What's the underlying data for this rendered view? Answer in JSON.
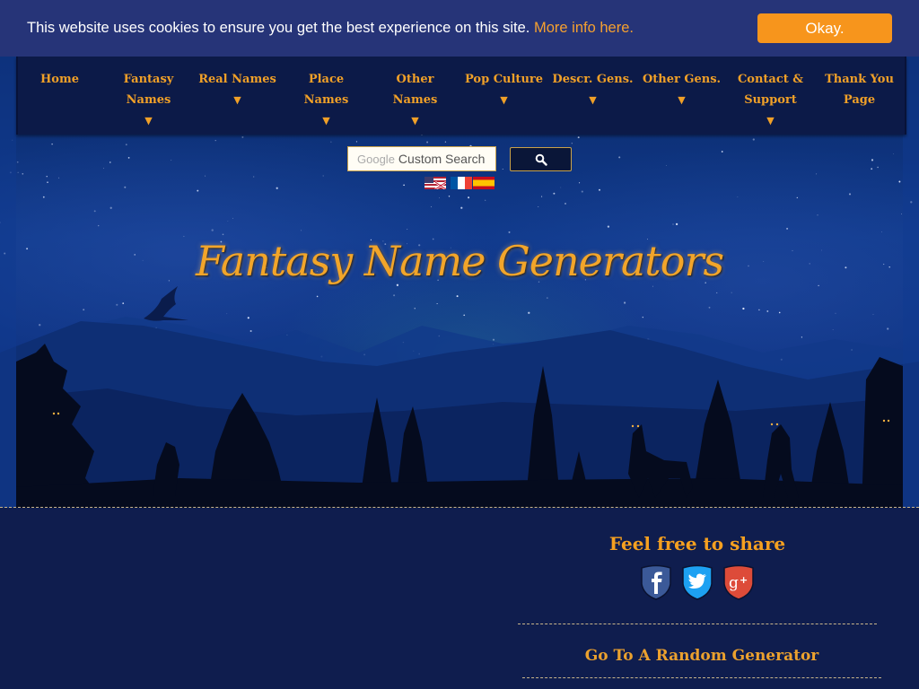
{
  "cookie_bar": {
    "message": "This website uses cookies to ensure you get the best experience on this site.",
    "more_info_link": "More info here.",
    "ok_button": "Okay."
  },
  "nav": {
    "items": [
      {
        "line1": "Home",
        "line2": "",
        "dropdown": false
      },
      {
        "line1": "Fantasy",
        "line2": "Names",
        "dropdown": true
      },
      {
        "line1": "Real Names",
        "line2": "",
        "dropdown": true
      },
      {
        "line1": "Place",
        "line2": "Names",
        "dropdown": true
      },
      {
        "line1": "Other",
        "line2": "Names",
        "dropdown": true
      },
      {
        "line1": "Pop Culture",
        "line2": "",
        "dropdown": true
      },
      {
        "line1": "Descr. Gens.",
        "line2": "",
        "dropdown": true
      },
      {
        "line1": "Other Gens.",
        "line2": "",
        "dropdown": true
      },
      {
        "line1": "Contact &",
        "line2": "Support",
        "dropdown": true
      },
      {
        "line1": "Thank You",
        "line2": "Page",
        "dropdown": false
      }
    ],
    "dropdown_glyph": "▼"
  },
  "search": {
    "brand_label": "Google",
    "placeholder": "Custom Search",
    "button_icon": "search-icon"
  },
  "languages": [
    {
      "name": "English",
      "icon": "uk-us-flag-icon"
    },
    {
      "name": "French",
      "icon": "france-flag-icon"
    },
    {
      "name": "Spanish",
      "icon": "spain-flag-icon"
    }
  ],
  "hero": {
    "title": "Fantasy Name Generators"
  },
  "share": {
    "title": "Feel free to share",
    "networks": [
      {
        "name": "Facebook",
        "icon": "facebook-icon",
        "color": "#3b5998"
      },
      {
        "name": "Twitter",
        "icon": "twitter-icon",
        "color": "#1da1f2"
      },
      {
        "name": "Google+",
        "icon": "google-plus-icon",
        "color": "#dd4b39"
      }
    ]
  },
  "random_generator_link": "Go To A Random Generator",
  "colors": {
    "accent": "#f5a020",
    "cookie_bar_bg": "#263478",
    "okay_button": "#f7951c",
    "nav_bg": "#0c1a48",
    "page_bg": "#0f1d4e"
  }
}
